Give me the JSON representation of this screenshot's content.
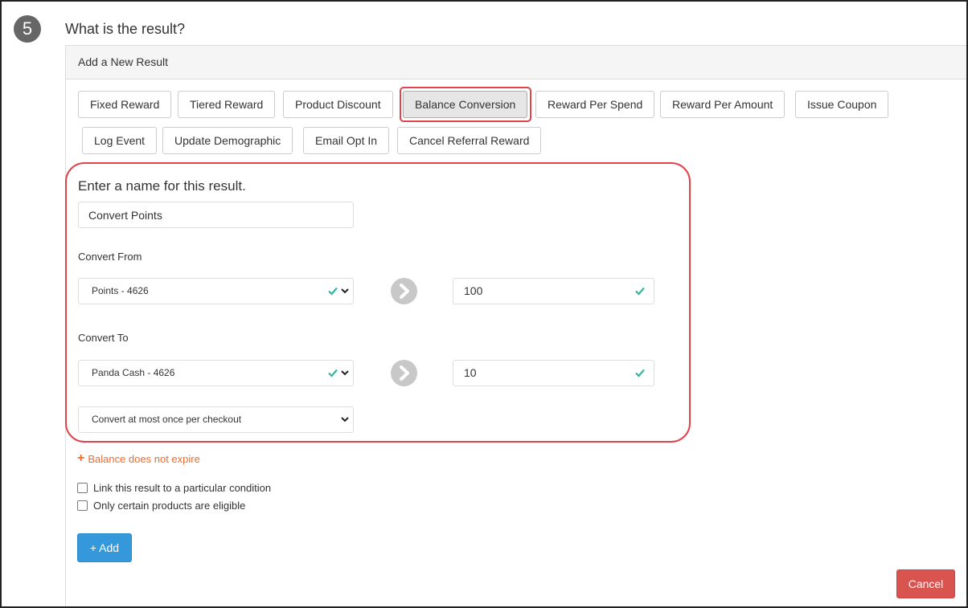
{
  "step": {
    "number": "5",
    "question": "What is the result?"
  },
  "panel": {
    "header": "Add a New Result"
  },
  "result_types": {
    "fixed_reward": "Fixed Reward",
    "tiered_reward": "Tiered Reward",
    "product_discount": "Product Discount",
    "balance_conversion": "Balance Conversion",
    "reward_per_spend": "Reward Per Spend",
    "reward_per_amount": "Reward Per Amount",
    "issue_coupon": "Issue Coupon",
    "log_event": "Log Event",
    "update_demographic": "Update Demographic",
    "email_opt_in": "Email Opt In",
    "cancel_referral_reward": "Cancel Referral Reward",
    "selected": "Balance Conversion"
  },
  "form": {
    "name_label": "Enter a name for this result.",
    "name_value": "Convert Points",
    "convert_from_label": "Convert From",
    "convert_from_select": "Points - 4626",
    "convert_from_amount": "100",
    "convert_to_label": "Convert To",
    "convert_to_select": "Panda Cash - 4626",
    "convert_to_amount": "10",
    "frequency_select": "Convert at most once per checkout"
  },
  "options": {
    "expire_link": "Balance does not expire",
    "link_condition": "Link this result to a particular condition",
    "products_eligible": "Only certain products are eligible"
  },
  "actions": {
    "add": "+ Add",
    "cancel": "Cancel"
  },
  "colors": {
    "highlight": "#e0434b",
    "valid_check": "#3bb3a0",
    "link_orange": "#f06a2b",
    "primary_blue": "#3498db",
    "danger_red": "#d9534f"
  }
}
